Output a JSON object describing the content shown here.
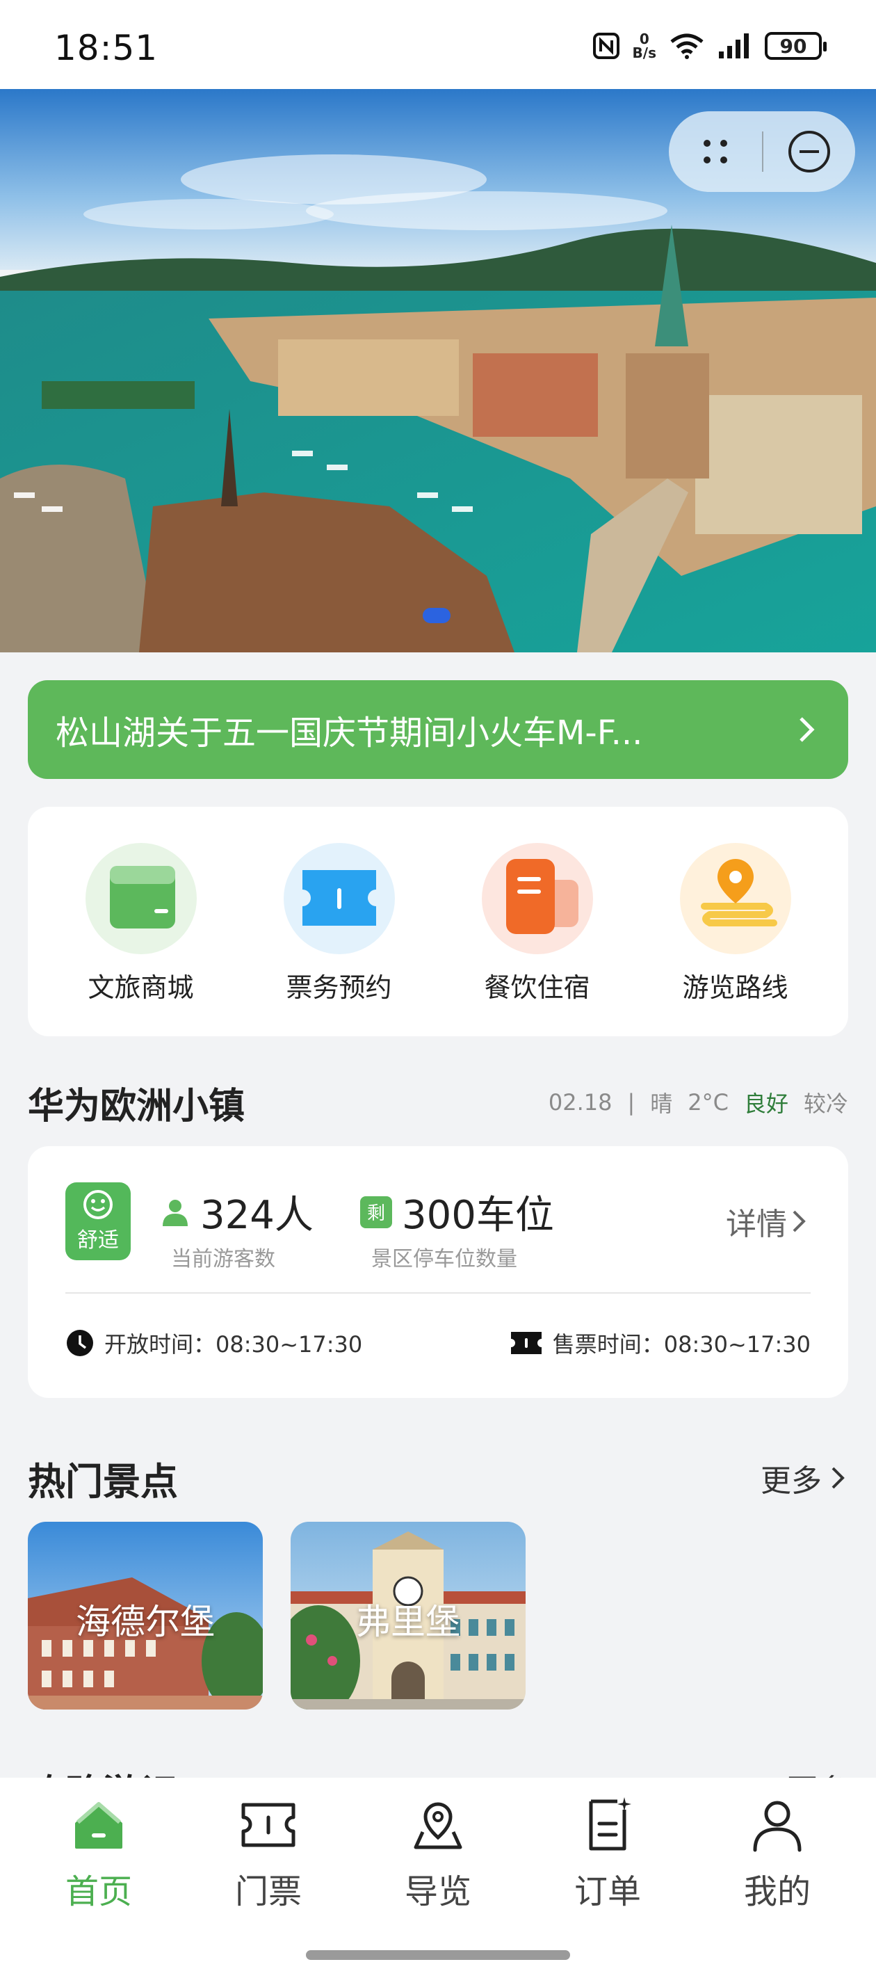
{
  "status_bar": {
    "time": "18:51",
    "net_speed_value": "0",
    "net_speed_unit": "B/s",
    "battery": "90",
    "icons": [
      "nfc-icon",
      "wifi-icon",
      "signal-icon",
      "battery-icon"
    ]
  },
  "hero": {
    "scene": "lakeside-old-town-photo",
    "carousel_index": 1
  },
  "notice": {
    "text": "松山湖关于五一国庆节期间小火车M-F..."
  },
  "quick_entries": [
    {
      "label": "文旅商城",
      "icon": "shop-icon",
      "color": "#5cb85c"
    },
    {
      "label": "票务预约",
      "icon": "ticket-icon",
      "color": "#29a3f0"
    },
    {
      "label": "餐饮住宿",
      "icon": "dining-icon",
      "color": "#f06a28"
    },
    {
      "label": "游览路线",
      "icon": "route-icon",
      "color": "#f5a623"
    }
  ],
  "town": {
    "title": "华为欧洲小镇",
    "date": "02.18",
    "separator": "|",
    "weather": "晴",
    "temperature": "2°C",
    "air": "良好",
    "feel": "较冷"
  },
  "info_card": {
    "comfort_label": "舒适",
    "visitors_value": "324人",
    "visitors_label": "当前游客数",
    "parking_badge": "剩",
    "parking_value": "300车位",
    "parking_label": "景区停车位数量",
    "detail_label": "详情",
    "open_time": "开放时间：08:30~17:30",
    "ticket_time": "售票时间：08:30~17:30"
  },
  "hot_spots": {
    "title": "热门景点",
    "more": "更多",
    "items": [
      {
        "name": "海德尔堡"
      },
      {
        "name": "弗里堡"
      }
    ]
  },
  "next_section": {
    "title": "攻略游记",
    "more": "更多"
  },
  "tabs": [
    {
      "label": "首页",
      "icon": "home-icon",
      "active": true
    },
    {
      "label": "门票",
      "icon": "ticket-icon",
      "active": false
    },
    {
      "label": "导览",
      "icon": "map-guide-icon",
      "active": false
    },
    {
      "label": "订单",
      "icon": "order-icon",
      "active": false
    },
    {
      "label": "我的",
      "icon": "user-icon",
      "active": false
    }
  ],
  "colors": {
    "accent_green": "#4caf50",
    "notice_green": "#5eb85a",
    "good_text": "#2f7d3a"
  }
}
